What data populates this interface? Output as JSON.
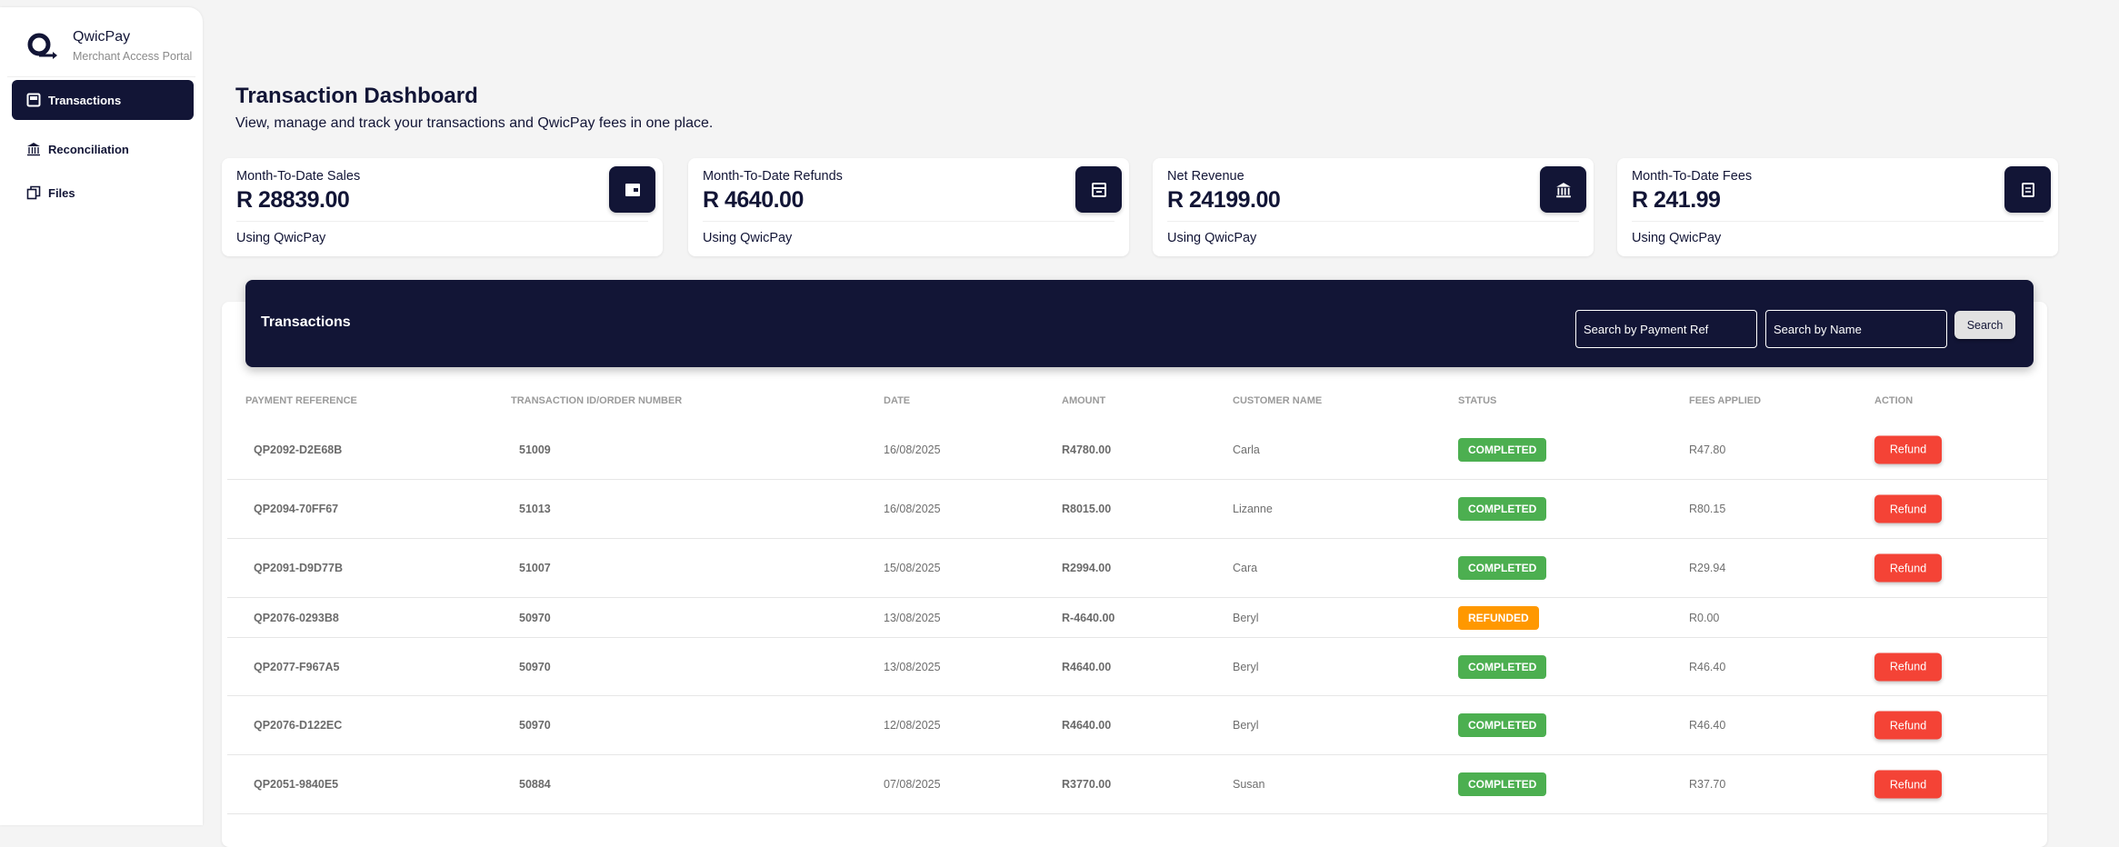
{
  "brand": {
    "name": "QwicPay",
    "subtitle": "Merchant Access Portal"
  },
  "nav": [
    {
      "label": "Transactions",
      "icon": "store-icon"
    },
    {
      "label": "Reconciliation",
      "icon": "bank-icon"
    },
    {
      "label": "Files",
      "icon": "files-icon"
    }
  ],
  "page": {
    "title": "Transaction Dashboard",
    "subtitle": "View, manage and track your transactions and QwicPay fees in one place."
  },
  "cards": [
    {
      "label": "Month-To-Date Sales",
      "value": "R 28839.00",
      "foot": "Using QwicPay",
      "icon": "wallet-icon"
    },
    {
      "label": "Month-To-Date Refunds",
      "value": "R 4640.00",
      "foot": "Using QwicPay",
      "icon": "receipt-icon"
    },
    {
      "label": "Net Revenue",
      "value": "R 24199.00",
      "foot": "Using QwicPay",
      "icon": "bank-icon"
    },
    {
      "label": "Month-To-Date Fees",
      "value": "R 241.99",
      "foot": "Using QwicPay",
      "icon": "document-icon"
    }
  ],
  "table": {
    "title": "Transactions",
    "search_ref_placeholder": "Search by Payment Ref",
    "search_name_placeholder": "Search by Name",
    "search_label": "Search",
    "columns": [
      "PAYMENT REFERENCE",
      "TRANSACTION ID/ORDER NUMBER",
      "DATE",
      "AMOUNT",
      "CUSTOMER NAME",
      "STATUS",
      "FEES APPLIED",
      "ACTION"
    ],
    "rows": [
      {
        "ref": "QP2092-D2E68B",
        "id": "51009",
        "date": "16/08/2025",
        "amount": "R4780.00",
        "name": "Carla",
        "status": "COMPLETED",
        "fees": "R47.80",
        "action": "Refund"
      },
      {
        "ref": "QP2094-70FF67",
        "id": "51013",
        "date": "16/08/2025",
        "amount": "R8015.00",
        "name": "Lizanne",
        "status": "COMPLETED",
        "fees": "R80.15",
        "action": "Refund"
      },
      {
        "ref": "QP2091-D9D77B",
        "id": "51007",
        "date": "15/08/2025",
        "amount": "R2994.00",
        "name": "Cara",
        "status": "COMPLETED",
        "fees": "R29.94",
        "action": "Refund"
      },
      {
        "ref": "QP2076-0293B8",
        "id": "50970",
        "date": "13/08/2025",
        "amount": "R-4640.00",
        "name": "Beryl",
        "status": "REFUNDED",
        "fees": "R0.00",
        "action": null
      },
      {
        "ref": "QP2077-F967A5",
        "id": "50970",
        "date": "13/08/2025",
        "amount": "R4640.00",
        "name": "Beryl",
        "status": "COMPLETED",
        "fees": "R46.40",
        "action": "Refund"
      },
      {
        "ref": "QP2076-D122EC",
        "id": "50970",
        "date": "12/08/2025",
        "amount": "R4640.00",
        "name": "Beryl",
        "status": "COMPLETED",
        "fees": "R46.40",
        "action": "Refund"
      },
      {
        "ref": "QP2051-9840E5",
        "id": "50884",
        "date": "07/08/2025",
        "amount": "R3770.00",
        "name": "Susan",
        "status": "COMPLETED",
        "fees": "R37.70",
        "action": "Refund"
      }
    ]
  },
  "colors": {
    "navy": "#121536",
    "completed": "#4caf50",
    "refunded": "#ff9800",
    "refund_button": "#f44336"
  }
}
